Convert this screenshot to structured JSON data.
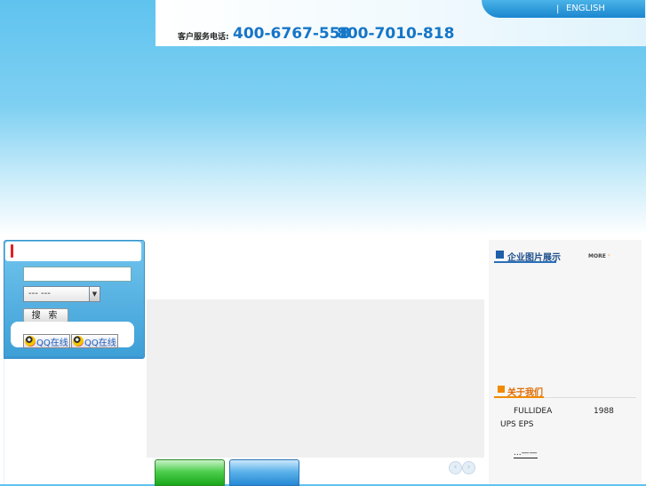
{
  "header": {
    "lang_separator": "|",
    "lang_link": "ENGLISH",
    "hotline_label": "客户服务电话:",
    "phone_1": "400-6767-558",
    "phone_2": "800-7010-818"
  },
  "search": {
    "input_value": "",
    "input_placeholder": "",
    "category_selected": "---   ---",
    "button_label": "搜 索"
  },
  "qq": {
    "button_1_label": "QQ在线",
    "button_2_label": "QQ在线"
  },
  "slider": {
    "prev_label": "‹",
    "next_label": "›"
  },
  "gallery": {
    "title": "企业图片展示",
    "more_label": "MORE",
    "more_arrow": "›"
  },
  "about": {
    "title": "关于我们",
    "line_1a": "FULLIDEA",
    "line_1b": "1988",
    "line_2": "UPS    EPS",
    "more_link": "...——"
  },
  "colors": {
    "accent_blue": "#1676c7",
    "accent_orange": "#f08a00",
    "tab_green": "#1aa71a",
    "tab_blue": "#2588d4"
  }
}
